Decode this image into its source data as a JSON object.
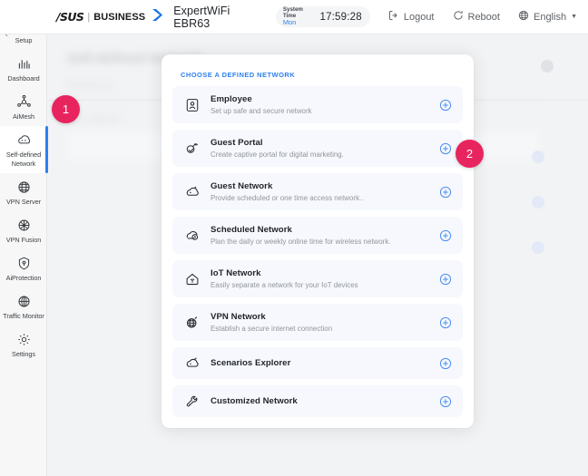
{
  "header": {
    "logo_asus": "/SUS",
    "logo_divider": "|",
    "logo_business": "BUSINESS",
    "chevron_icon": "chevron-right-icon",
    "model": "ExpertWiFi EBR63",
    "system_time_label": "System Time",
    "system_time_day": "Mon",
    "system_time_clock": "17:59:28",
    "logout": "Logout",
    "reboot": "Reboot",
    "language": "English",
    "language_caret": "▼"
  },
  "sidebar": {
    "items": [
      {
        "label": "Quick Internet Setup",
        "icon": "quick-internet-setup-icon",
        "active": false
      },
      {
        "label": "Dashboard",
        "icon": "dashboard-icon",
        "active": false
      },
      {
        "label": "AiMesh",
        "icon": "aimesh-icon",
        "active": false
      },
      {
        "label": "Self-defined Network",
        "icon": "self-defined-network-icon",
        "active": true
      },
      {
        "label": "VPN Server",
        "icon": "vpn-server-icon",
        "active": false
      },
      {
        "label": "VPN Fusion",
        "icon": "vpn-fusion-icon",
        "active": false
      },
      {
        "label": "AiProtection",
        "icon": "aiprotection-shield-icon",
        "active": false
      },
      {
        "label": "Traffic Monitor",
        "icon": "traffic-monitor-icon",
        "active": false
      },
      {
        "label": "Settings",
        "icon": "settings-gear-icon",
        "active": false
      }
    ]
  },
  "backdrop": {
    "page_title": "Self-defined Network",
    "sub_text": "Network List",
    "row_text": "Add a Network"
  },
  "modal": {
    "heading": "CHOOSE A DEFINED NETWORK",
    "networks": [
      {
        "title": "Employee",
        "desc": "Set up safe and secure network",
        "icon": "employee-badge-icon",
        "add_icon": "plus-circle-icon"
      },
      {
        "title": "Guest Portal",
        "desc": "Create captive portal for digital marketing.",
        "icon": "guest-portal-hand-icon",
        "add_icon": "plus-circle-icon"
      },
      {
        "title": "Guest Network",
        "desc": "Provide scheduled or one time access network..",
        "icon": "guest-network-icon",
        "add_icon": "plus-circle-icon"
      },
      {
        "title": "Scheduled Network",
        "desc": "Plan the daily or weekly online time for wireless network.",
        "icon": "scheduled-network-clock-icon",
        "add_icon": "plus-circle-icon"
      },
      {
        "title": "IoT Network",
        "desc": "Easily separate a network for your IoT devices",
        "icon": "iot-network-home-icon",
        "add_icon": "plus-circle-icon"
      },
      {
        "title": "VPN Network",
        "desc": "Establish a secure internet connection",
        "icon": "vpn-network-globe-icon",
        "add_icon": "plus-circle-icon"
      },
      {
        "title": "Scenarios Explorer",
        "desc": "",
        "icon": "scenarios-explorer-icon",
        "add_icon": "plus-circle-icon"
      },
      {
        "title": "Customized Network",
        "desc": "",
        "icon": "customized-network-wrench-icon",
        "add_icon": "plus-circle-icon"
      }
    ]
  },
  "annotations": {
    "badges": [
      {
        "number": "1",
        "target": "sidebar-item-self-defined-network"
      },
      {
        "number": "2",
        "target": "network-row-guest-portal-add"
      }
    ]
  },
  "colors": {
    "accent_blue": "#2f80ed",
    "badge_pink": "#e8245f",
    "row_bg": "#f6f8fd",
    "page_bg": "#f2f3f4"
  }
}
